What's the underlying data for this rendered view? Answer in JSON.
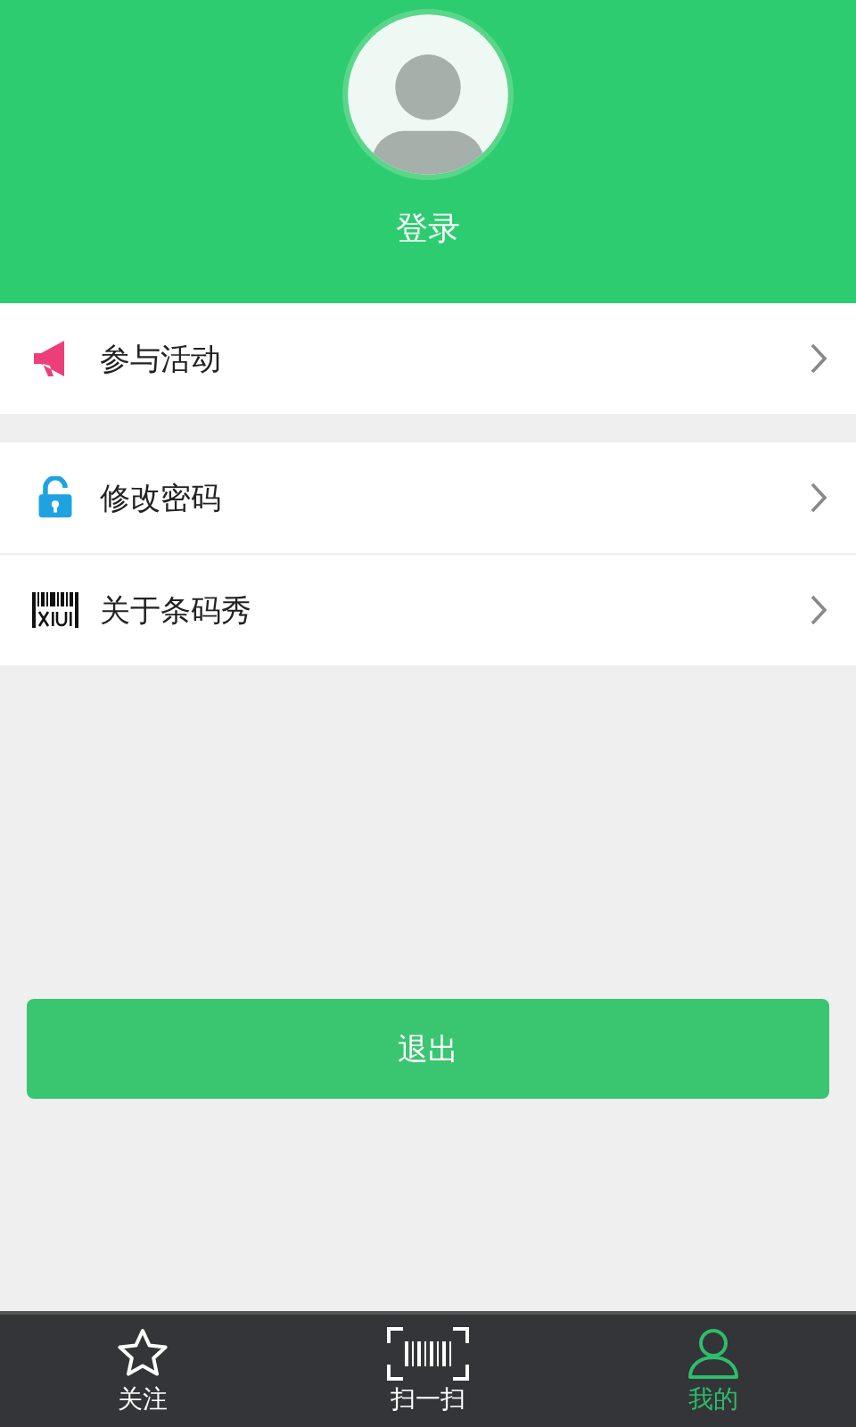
{
  "header": {
    "login_label": "登录"
  },
  "menu_groups": [
    {
      "items": [
        {
          "kind": "megaphone",
          "label": "参与活动"
        }
      ]
    },
    {
      "items": [
        {
          "kind": "lock",
          "label": "修改密码"
        },
        {
          "kind": "barcode",
          "label": "关于条码秀"
        }
      ]
    }
  ],
  "logout_button": "退出",
  "tab_bar": [
    {
      "kind": "star",
      "label": "关注",
      "selected": false
    },
    {
      "kind": "scan",
      "label": "扫一扫",
      "selected": false
    },
    {
      "kind": "person",
      "label": "我的",
      "selected": true
    }
  ]
}
